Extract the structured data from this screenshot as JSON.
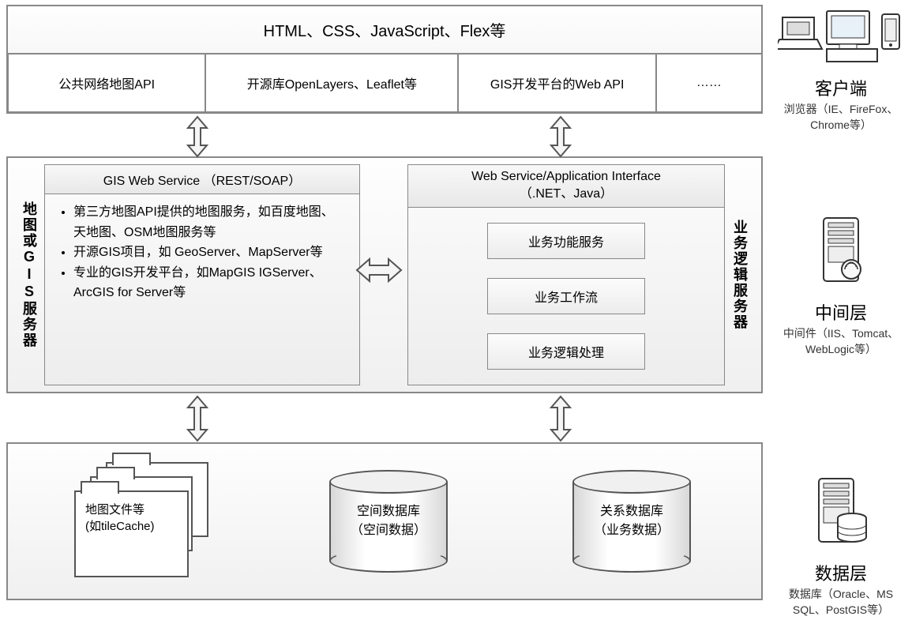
{
  "layer1": {
    "top": "HTML、CSS、JavaScript、Flex等",
    "cells": [
      "公共网络地图API",
      "开源库OpenLayers、Leaflet等",
      "GIS开发平台的Web API",
      "……"
    ]
  },
  "layer2": {
    "leftLabel": "地图或GIS服务器",
    "gisHeader": "GIS Web Service （REST/SOAP）",
    "gisItems": [
      "第三方地图API提供的地图服务，如百度地图、天地图、OSM地图服务等",
      "开源GIS项目，如 GeoServer、MapServer等",
      "专业的GIS开发平台，如MapGIS IGServer、ArcGIS for Server等"
    ],
    "bizHeader1": "Web Service/Application Interface",
    "bizHeader2": "（.NET、Java）",
    "bizItems": [
      "业务功能服务",
      "业务工作流",
      "业务逻辑处理"
    ],
    "rightLabel": "业务逻辑服务器"
  },
  "layer3": {
    "folderLine1": "地图文件等",
    "folderLine2": "(如tileCache)",
    "cyl1a": "空间数据库",
    "cyl1b": "（空间数据）",
    "cyl2a": "关系数据库",
    "cyl2b": "（业务数据）"
  },
  "side": {
    "client": {
      "title": "客户端",
      "sub": "浏览器（IE、FireFox、Chrome等）"
    },
    "middle": {
      "title": "中间层",
      "sub": "中间件（IIS、Tomcat、WebLogic等）"
    },
    "data": {
      "title": "数据层",
      "sub": "数据库（Oracle、MS SQL、PostGIS等）"
    }
  }
}
